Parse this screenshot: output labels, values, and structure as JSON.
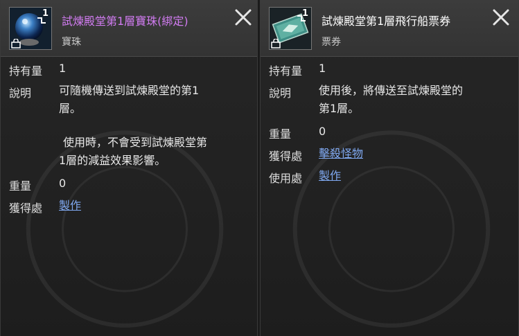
{
  "left_card": {
    "title": "試煉殿堂第1層寶珠(綁定)",
    "category": "寶珠",
    "icon": "crystal-orb-icon",
    "count_badge": "1",
    "title_color": "#d27cf2",
    "rows": {
      "quantity_label": "持有量",
      "quantity_value": "1",
      "desc_label": "說明",
      "desc_line1": "可隨機傳送到試煉殿堂的第1",
      "desc_line2": "層。",
      "desc_line3": "使用時，不會受到試煉殿堂第",
      "desc_line4": "1層的減益效果影響。",
      "weight_label": "重量",
      "weight_value": "0",
      "source_label": "獲得處",
      "source_link": "製作"
    }
  },
  "right_card": {
    "title": "試煉殿堂第1層飛行船票券",
    "category": "票券",
    "icon": "airship-ticket-icon",
    "count_badge": "1",
    "title_color": "#ffffff",
    "rows": {
      "quantity_label": "持有量",
      "quantity_value": "1",
      "desc_label": "說明",
      "desc_line1": "使用後，將傳送至試煉殿堂的",
      "desc_line2": "第1層。",
      "weight_label": "重量",
      "weight_value": "0",
      "source_label": "獲得處",
      "source_link": "擊殺怪物",
      "use_label": "使用處",
      "use_link": "製作"
    }
  },
  "colors": {
    "link": "#7fa8f0",
    "panel_bg": "#242424",
    "header_bg": "#383838"
  }
}
